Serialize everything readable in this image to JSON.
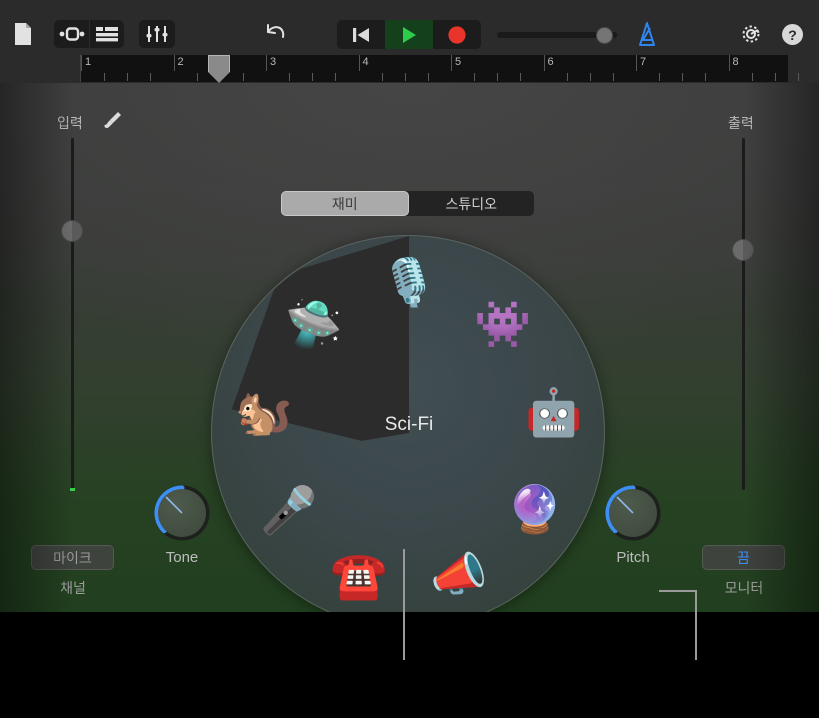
{
  "toolbar": {
    "file_icon": "document-icon",
    "loop_browser_icon": "loop-browser-icon",
    "track_list_icon": "track-list-icon",
    "mixer_icon": "mixer-sliders-icon",
    "undo_icon": "undo-arrow-icon",
    "rewind_icon": "rewind-to-start-icon",
    "play_icon": "play-icon",
    "record_icon": "record-icon",
    "metronome_icon": "metronome-icon",
    "settings_icon": "gear-icon",
    "help_label": "?",
    "master_volume_percent": 82,
    "metronome_active": true,
    "playing": true
  },
  "ruler": {
    "bars": [
      "1",
      "2",
      "3",
      "4",
      "5",
      "6",
      "7",
      "8"
    ],
    "playhead_bar": "2.5",
    "add_track_label": "+"
  },
  "mode_switch": {
    "options": [
      {
        "label": "재미",
        "selected": true
      },
      {
        "label": "스튜디오",
        "selected": false
      }
    ]
  },
  "input": {
    "label": "입력",
    "icon": "audio-jack-icon",
    "fader_value": 76,
    "level_meter": "green-level-led",
    "channel_button_label": "마이크",
    "channel_caption": "채널",
    "tone_knob_label": "Tone",
    "tone_value": 30
  },
  "output": {
    "label": "출력",
    "fader_value": 68,
    "pitch_knob_label": "Pitch",
    "pitch_value": 30,
    "monitor_button_label": "끔",
    "monitor_caption": "모니터"
  },
  "effect_wheel": {
    "selected_name": "Sci-Fi",
    "selected_index": 8,
    "effects": [
      {
        "name": "Clean",
        "icon": "studio-microphone-icon",
        "glyph": "🎙️"
      },
      {
        "name": "Monster",
        "icon": "monster-icon",
        "glyph": "👾"
      },
      {
        "name": "Robot",
        "icon": "robot-icon",
        "glyph": "🤖"
      },
      {
        "name": "Helium",
        "icon": "bubbles-icon",
        "glyph": "🔮"
      },
      {
        "name": "Megaphone",
        "icon": "megaphone-icon",
        "glyph": "📣"
      },
      {
        "name": "Telephone",
        "icon": "telephone-icon",
        "glyph": "☎️"
      },
      {
        "name": "Karaoke",
        "icon": "handheld-microphone-icon",
        "glyph": "🎤"
      },
      {
        "name": "Chipmunk",
        "icon": "chipmunk-icon",
        "glyph": "🐿️"
      },
      {
        "name": "Sci-Fi",
        "icon": "ufo-icon",
        "glyph": "🛸"
      }
    ]
  },
  "colors": {
    "accent_blue": "#3e8ef7",
    "record_red": "#e8342a",
    "play_green": "#2ecc4a",
    "panel_green": "#21401f",
    "toolbar_gray": "#2b2b2b",
    "level_green": "#35d14a"
  }
}
